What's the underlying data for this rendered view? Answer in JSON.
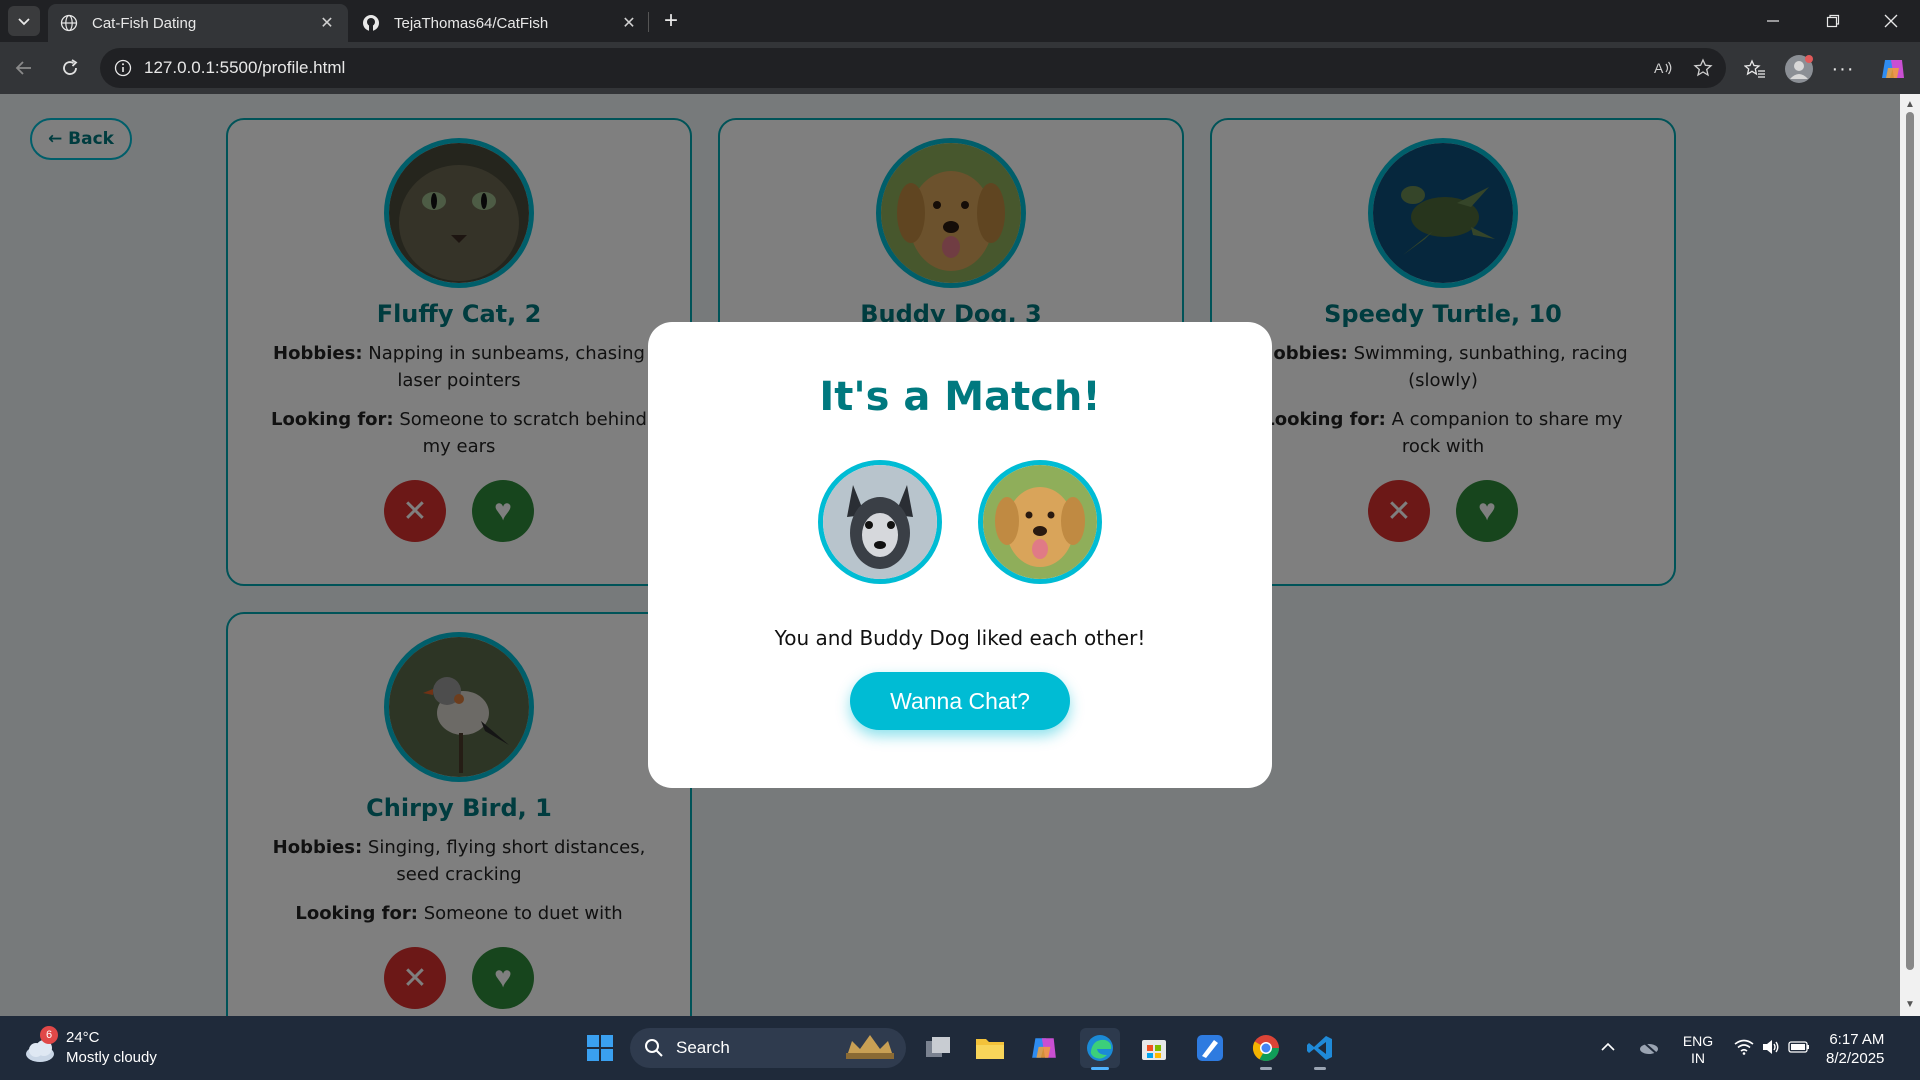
{
  "browser": {
    "tabs": [
      {
        "title": "Cat-Fish Dating",
        "icon": "globe-icon",
        "active": true
      },
      {
        "title": "TejaThomas64/CatFish",
        "icon": "github-icon",
        "active": false
      }
    ],
    "address": "127.0.0.1:5500/profile.html"
  },
  "page": {
    "back_label": "← Back",
    "hobbies_label": "Hobbies:",
    "looking_label": "Looking for:",
    "profiles": [
      {
        "name": "Fluffy Cat, 2",
        "hobbies": "Napping in sunbeams, chasing laser pointers",
        "looking": "Someone to scratch behind my ears"
      },
      {
        "name": "Buddy Dog, 3",
        "hobbies": "",
        "looking": ""
      },
      {
        "name": "Speedy Turtle, 10",
        "hobbies": "Swimming, sunbathing, racing (slowly)",
        "looking": "A companion to share my rock with"
      },
      {
        "name": "Chirpy Bird, 1",
        "hobbies": "Singing, flying short distances, seed cracking",
        "looking": "Someone to duet with"
      }
    ],
    "nope_symbol": "✕",
    "like_symbol": "♥"
  },
  "modal": {
    "title": "It's a Match!",
    "message": "You and Buddy Dog liked each other!",
    "cta": "Wanna Chat?"
  },
  "taskbar": {
    "weather_badge": "6",
    "temperature": "24°C",
    "condition": "Mostly cloudy",
    "search_label": "Search",
    "lang_line1": "ENG",
    "lang_line2": "IN",
    "time": "6:17 AM",
    "date": "8/2/2025"
  },
  "colors": {
    "accent": "#00bcd4",
    "title_teal": "#00797f",
    "nope": "#d9312f",
    "like": "#2e8b3a"
  }
}
